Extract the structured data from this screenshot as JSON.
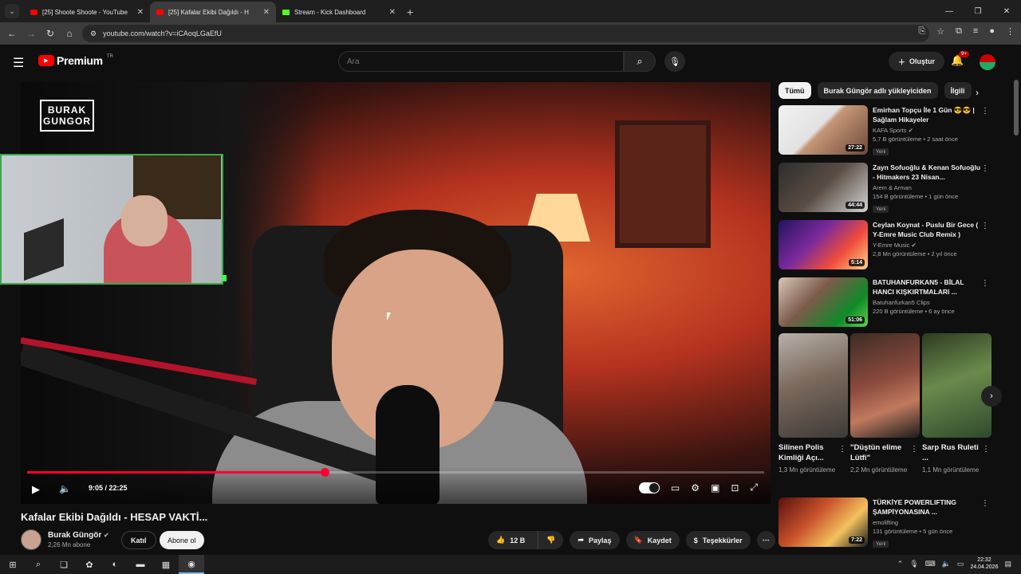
{
  "browser": {
    "tabs": [
      {
        "title": "[25] Shoote Shoote - YouTube",
        "icon": "youtube-icon"
      },
      {
        "title": "[25] Kafalar Ekibi Dağıldı - H",
        "icon": "youtube-icon"
      },
      {
        "title": "Stream - Kick Dashboard",
        "icon": "kick-icon"
      }
    ],
    "url": "youtube.com/watch?v=iCAoqLGaEfU"
  },
  "masthead": {
    "logo_text": "Premium",
    "region": "TR",
    "search_placeholder": "Ara",
    "create_label": "Oluştur",
    "notification_count": "9+"
  },
  "player": {
    "brand_line1": "BURAK",
    "brand_line2": "GUNGOR",
    "current_time": "9:05",
    "duration": "22:25",
    "progress": 0.404
  },
  "video": {
    "title": "Kafalar Ekibi Dağıldı - HESAP VAKTİ...",
    "channel": "Burak Güngör",
    "subscribers": "2,26 Mn abone",
    "join_label": "Katıl",
    "subscribe_label": "Abone ol",
    "likes": "12 B",
    "share_label": "Paylaş",
    "save_label": "Kaydet",
    "thanks_label": "Teşekkürler"
  },
  "chips": [
    "Tümü",
    "Burak Güngör adlı yükleyiciden",
    "İlgili"
  ],
  "recommendations": [
    {
      "title": "Emirhan Topçu İle 1 Gün 😎😎 | Sağlam Hikayeler",
      "channel": "KAFA Sports",
      "verified": true,
      "stats": "5,7 B görüntüleme • 2 saat önce",
      "duration": "27:22",
      "badge": "Yeni"
    },
    {
      "title": "Zayn Sofuoğlu & Kenan Sofuoğlu - Hitmakers 23 Nisan...",
      "channel": "Arem & Arman",
      "verified": false,
      "stats": "154 B görüntüleme • 1 gün önce",
      "duration": "44:44",
      "badge": "Yeni"
    },
    {
      "title": "Ceylan Koynat - Puslu Bir Gece ( Y-Emre Music Club Remix )",
      "channel": "Y-Emre Music",
      "verified": true,
      "stats": "2,8 Mn görüntüleme • 2 yıl önce",
      "duration": "5:14",
      "badge": ""
    },
    {
      "title": "BATUHANFURKAN5 - BİLAL HANCI KIŞKIRTMALARI ...",
      "channel": "Batuhanfurkan5 Clips",
      "verified": false,
      "stats": "220 B görüntüleme • 6 ay önce",
      "duration": "51:06",
      "badge": ""
    }
  ],
  "shorts": [
    {
      "title": "Silinen Polis Kimliği Açı...",
      "views": "1,3 Mn görüntüleme"
    },
    {
      "title": "\"Düştün elime Lütfi\"",
      "views": "2,2 Mn görüntüleme"
    },
    {
      "title": "Sarp Rus Ruleti ...",
      "views": "1,1 Mn görüntüleme"
    }
  ],
  "rec_bottom": {
    "title": "TÜRKİYE POWERLIFTING ŞAMPİYONASINA ...",
    "channel": "emolifting",
    "stats": "131 görüntüleme • 5 gün önce",
    "duration": "7:22",
    "badge": "Yeni"
  },
  "taskbar": {
    "time": "22:32",
    "date": "24.04.2026"
  }
}
